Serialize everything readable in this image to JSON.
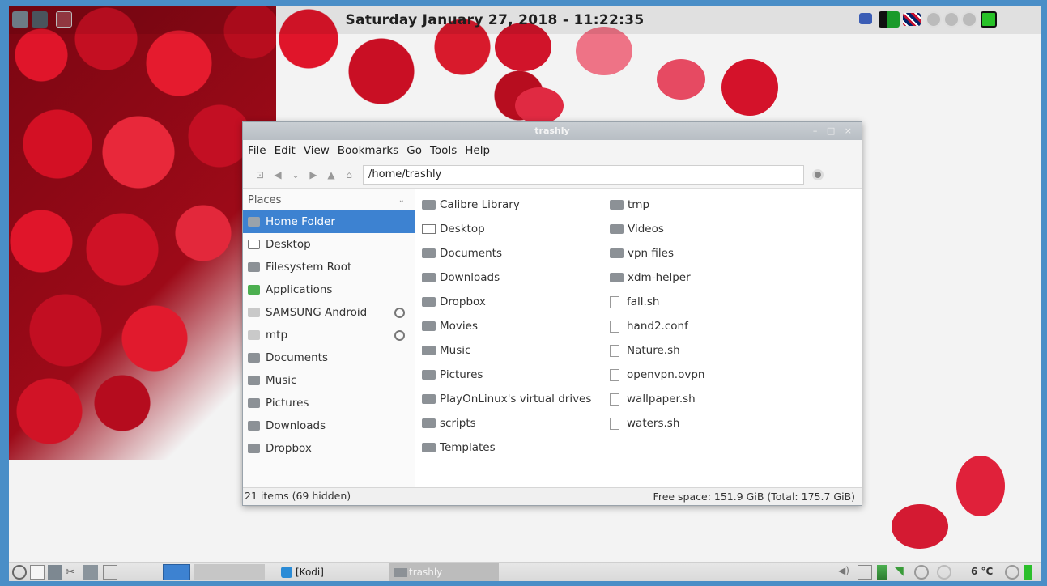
{
  "top_panel": {
    "clock": "Saturday January 27, 2018 - 11:22:35"
  },
  "window": {
    "title": "trashly",
    "controls": "– □ ×",
    "menu": [
      "File",
      "Edit",
      "View",
      "Bookmarks",
      "Go",
      "Tools",
      "Help"
    ],
    "path": "/home/trashly",
    "sidebar": {
      "header": "Places",
      "items": [
        {
          "label": "Home Folder",
          "icon": "home-icon",
          "active": true
        },
        {
          "label": "Desktop",
          "icon": "desktop-icon"
        },
        {
          "label": "Filesystem Root",
          "icon": "folder-icon"
        },
        {
          "label": "Applications",
          "icon": "applications-icon"
        },
        {
          "label": "SAMSUNG Android",
          "icon": "phone-icon",
          "eject": true
        },
        {
          "label": "mtp",
          "icon": "drive-icon",
          "eject": true
        },
        {
          "label": "Documents",
          "icon": "folder-icon"
        },
        {
          "label": "Music",
          "icon": "folder-icon"
        },
        {
          "label": "Pictures",
          "icon": "folder-icon"
        },
        {
          "label": "Downloads",
          "icon": "folder-icon"
        },
        {
          "label": "Dropbox",
          "icon": "folder-icon"
        }
      ]
    },
    "files_col1": [
      {
        "name": "Calibre Library",
        "kind": "folder"
      },
      {
        "name": "Desktop",
        "kind": "desktop"
      },
      {
        "name": "Documents",
        "kind": "folder"
      },
      {
        "name": "Downloads",
        "kind": "folder"
      },
      {
        "name": "Dropbox",
        "kind": "folder"
      },
      {
        "name": "Movies",
        "kind": "folder"
      },
      {
        "name": "Music",
        "kind": "folder"
      },
      {
        "name": "Pictures",
        "kind": "folder"
      },
      {
        "name": "PlayOnLinux's virtual drives",
        "kind": "folder"
      },
      {
        "name": "scripts",
        "kind": "folder"
      },
      {
        "name": "Templates",
        "kind": "folder"
      }
    ],
    "files_col2": [
      {
        "name": "tmp",
        "kind": "folder"
      },
      {
        "name": "Videos",
        "kind": "folder"
      },
      {
        "name": "vpn files",
        "kind": "folder"
      },
      {
        "name": "xdm-helper",
        "kind": "folder"
      },
      {
        "name": "fall.sh",
        "kind": "file"
      },
      {
        "name": "hand2.conf",
        "kind": "file"
      },
      {
        "name": "Nature.sh",
        "kind": "file"
      },
      {
        "name": "openvpn.ovpn",
        "kind": "file"
      },
      {
        "name": "wallpaper.sh",
        "kind": "file"
      },
      {
        "name": "waters.sh",
        "kind": "file"
      }
    ],
    "status_left": "21 items (69 hidden)",
    "status_right": "Free space: 151.9 GiB (Total: 175.7 GiB)"
  },
  "bottom_panel": {
    "tasks": [
      "[Kodi]",
      "trashly"
    ],
    "temperature": "6 °C"
  }
}
